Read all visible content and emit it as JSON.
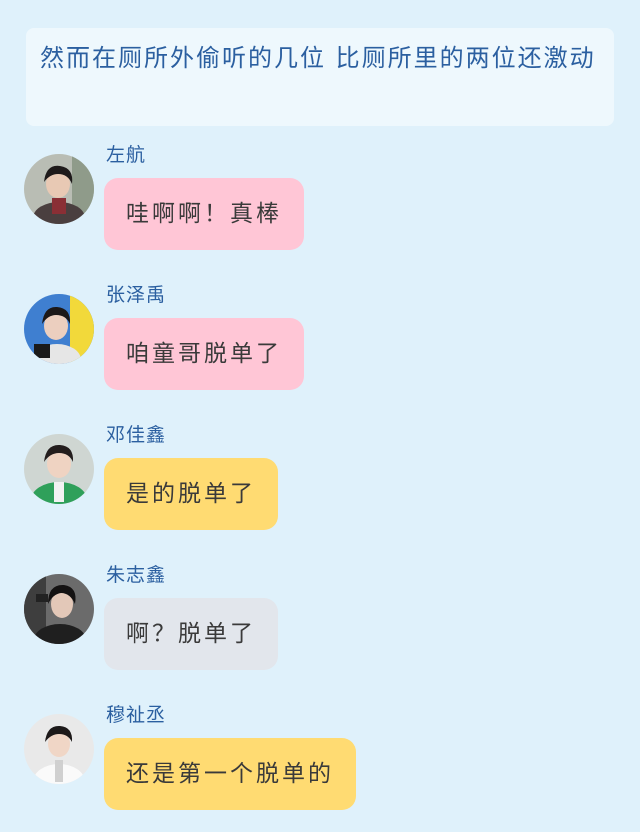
{
  "narration": "然而在厕所外偷听的几位 比厕所里的两位还激动",
  "messages": [
    {
      "name": "左航",
      "text": "哇啊啊！真棒",
      "bubble_color": "#ffc6d6",
      "avatar": "avatar-photo-zuo-hang"
    },
    {
      "name": "张泽禹",
      "text": "咱童哥脱单了",
      "bubble_color": "#ffc6d6",
      "avatar": "avatar-photo-zhang-zeyu"
    },
    {
      "name": "邓佳鑫",
      "text": "是的脱单了",
      "bubble_color": "#ffdb72",
      "avatar": "avatar-photo-deng-jiaxin"
    },
    {
      "name": "朱志鑫",
      "text": "啊？脱单了",
      "bubble_color": "#e2e6ec",
      "avatar": "avatar-photo-zhu-zhixin"
    },
    {
      "name": "穆祉丞",
      "text": "还是第一个脱单的",
      "bubble_color": "#ffdb72",
      "avatar": "avatar-photo-mu-zhicheng"
    }
  ],
  "colors": {
    "background": "#dff1fb",
    "narration_box": "#eef8fd",
    "name_text": "#2b5fa0"
  }
}
